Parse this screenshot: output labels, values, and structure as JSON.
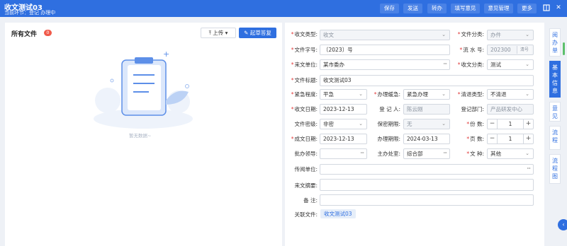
{
  "header": {
    "title": "收文测试03",
    "subtitle": "当前环节：登记 办理中",
    "buttons": [
      "保存",
      "发送",
      "转办",
      "填写意见",
      "意见管理",
      "更多"
    ]
  },
  "left": {
    "title": "所有文件",
    "count": "0",
    "upload": "上传",
    "draft": "起草答复",
    "empty": "暂无数据~"
  },
  "form": {
    "l_type": "收文类型:",
    "v_type": "收文",
    "l_cat": "文件分类:",
    "v_cat": "办件",
    "l_no": "文件字号:",
    "v_no": "〔2023〕号",
    "l_flow": "流 水 号:",
    "v_flow": "202300",
    "qh": "清号",
    "l_from": "来文单位:",
    "v_from": "某市委办",
    "l_class": "收文分类:",
    "v_class": "测试",
    "l_title": "文件标题:",
    "v_title": "收文测试03",
    "l_urg": "紧急程度:",
    "v_urg": "平急",
    "l_slow": "办理缓急:",
    "v_slow": "紧急办理",
    "l_clean": "清退类型:",
    "v_clean": "不清退",
    "l_date": "收文日期:",
    "v_date": "2023-12-13",
    "l_reg": "登 记 人:",
    "v_reg": "陈云刚",
    "l_dept": "登记部门:",
    "v_dept": "产品研发中心",
    "l_sec": "文件密级:",
    "v_sec": "非密",
    "l_secp": "保密期限:",
    "v_secp": "无",
    "l_copies": "份 数:",
    "v_copies": "1",
    "l_cdate": "成文日期:",
    "v_cdate": "2023-12-13",
    "l_deadline": "办理期限:",
    "v_deadline": "2024-03-13",
    "l_pages": "页 数:",
    "v_pages": "1",
    "l_leader": "批办领导:",
    "l_main": "主办处室:",
    "v_main": "综合部",
    "l_kind": "文 种:",
    "v_kind": "其他",
    "l_circ": "传阅单位:",
    "l_summary": "来文摘要:",
    "l_note": "备 注:",
    "l_rel": "关联文件:",
    "v_rel": "收文测试03"
  },
  "side_tabs": [
    "阅办单",
    "基本信息",
    "意见",
    "流程",
    "流程图"
  ],
  "colors": {
    "primary": "#2f6fe0",
    "required": "#e03a3a"
  }
}
